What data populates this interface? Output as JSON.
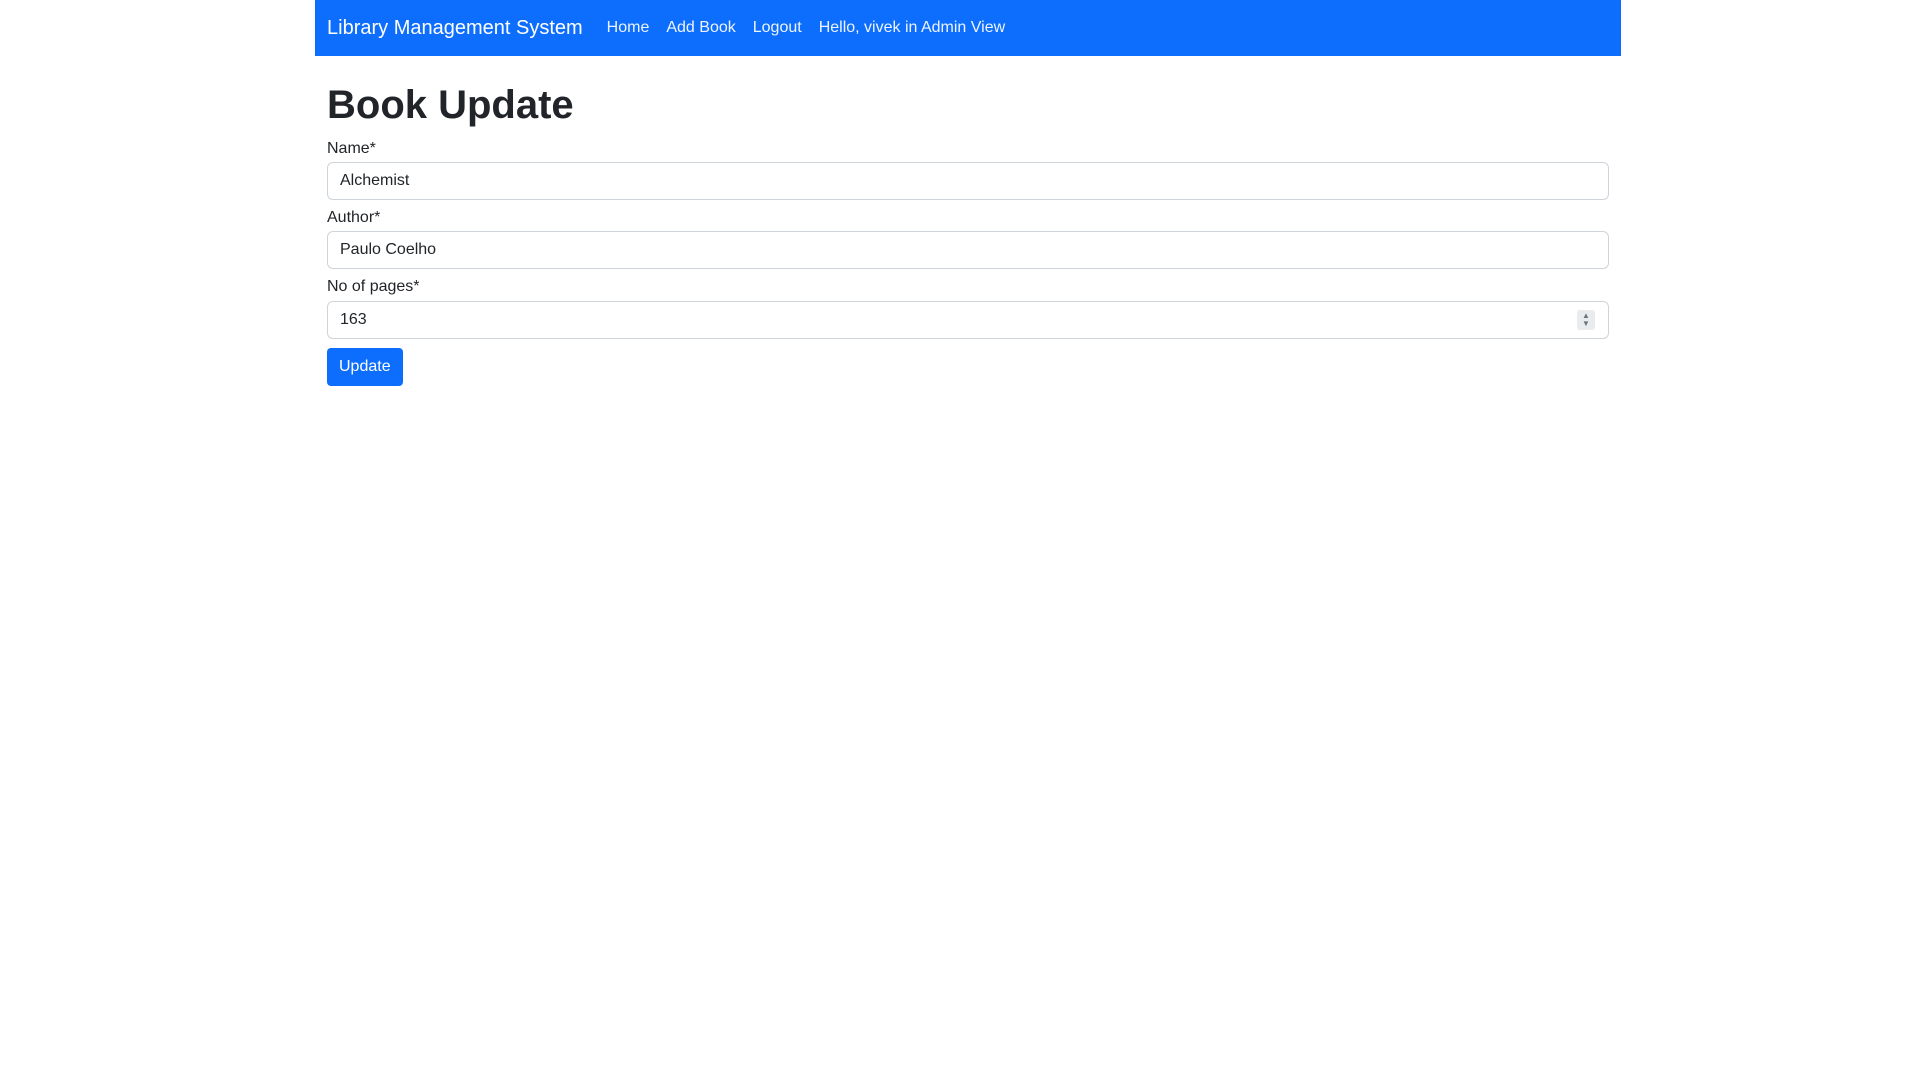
{
  "navbar": {
    "brand": "Library Management System",
    "links": [
      {
        "label": "Home"
      },
      {
        "label": "Add Book"
      },
      {
        "label": "Logout"
      },
      {
        "label": "Hello, vivek in Admin View"
      }
    ],
    "color": "#0d6efd"
  },
  "page": {
    "title": "Book Update"
  },
  "form": {
    "name": {
      "label": "Name*",
      "value": "Alchemist"
    },
    "author": {
      "label": "Author*",
      "value": "Paulo Coelho"
    },
    "pages": {
      "label": "No of pages*",
      "value": "163"
    },
    "submit_label": "Update"
  }
}
